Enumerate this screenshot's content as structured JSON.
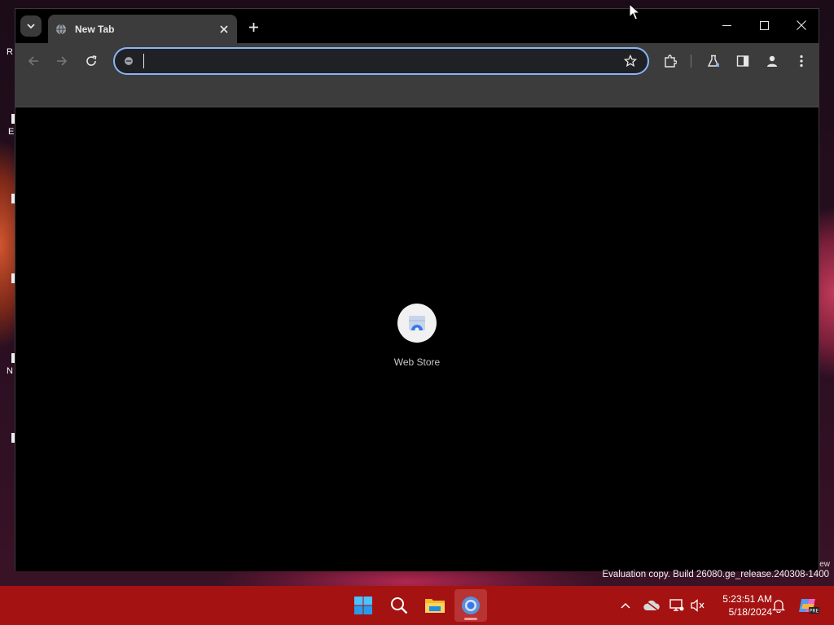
{
  "desktop": {
    "icon_labels": [
      "R",
      "E",
      "N"
    ]
  },
  "browser": {
    "tab": {
      "title": "New Tab"
    },
    "omnibox": {
      "value": "",
      "placeholder": ""
    },
    "shortcuts": [
      {
        "label": "Web Store",
        "icon": "chrome-web-store-icon"
      }
    ],
    "colors": {
      "frame": "#000000",
      "toolbar": "#3c3c3c",
      "omnibox_border": "#8ab4f8"
    }
  },
  "watermark": {
    "text": "Evaluation copy. Build 26080.ge_release.240308-1400",
    "edge_fragment": "ew"
  },
  "taskbar": {
    "color": "#a51212",
    "apps": [
      "start-icon",
      "search-icon",
      "file-explorer-icon",
      "chrome-icon"
    ],
    "clock": {
      "time": "5:23:51 AM",
      "date": "5/18/2024"
    },
    "tray_badge": "PRE"
  }
}
